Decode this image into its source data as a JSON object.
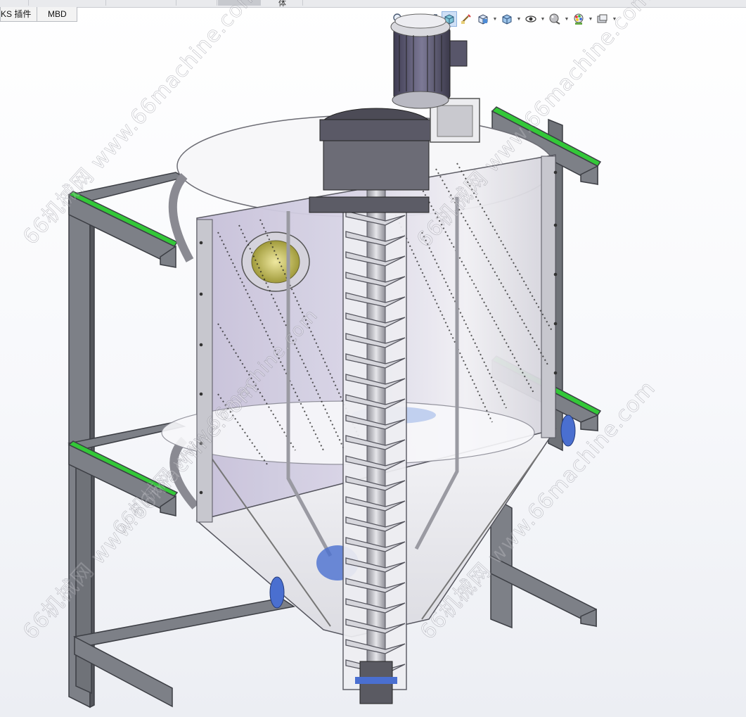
{
  "command_tabs": [
    {
      "label": "KS 插件"
    },
    {
      "label": "MBD"
    }
  ],
  "top_strip": {
    "partial_char": "体"
  },
  "heads_up_toolbar": [
    {
      "icon": "zoom-to-fit-icon"
    },
    {
      "icon": "zoom-to-area-icon"
    },
    {
      "icon": "previous-view-icon"
    },
    {
      "icon": "section-view-icon",
      "active": true
    },
    {
      "icon": "dynamic-annotation-icon"
    },
    {
      "icon": "view-orientation-icon",
      "dropdown": true
    },
    {
      "icon": "display-style-icon",
      "dropdown": true
    },
    {
      "icon": "hide-show-items-icon",
      "dropdown": true
    },
    {
      "icon": "edit-appearance-icon",
      "dropdown": true
    },
    {
      "icon": "apply-scene-icon",
      "dropdown": true
    },
    {
      "icon": "view-settings-icon",
      "dropdown": true
    }
  ],
  "watermarks": [
    {
      "text": "66机械网 www.66machine.com"
    },
    {
      "text": "66机械网 www.66machine.com"
    },
    {
      "text": "66机械网 www.66machine.com"
    },
    {
      "text": "66机械网 www.66machine.com"
    },
    {
      "text": "66机械网 www.66machine.com"
    }
  ],
  "colors": {
    "frame_steel": "#7d8087",
    "frame_highlight": "#35c83a",
    "tank_glass": "#c9c4dc",
    "motor_body": "#5b5870",
    "flange_blue": "#4a6fd0",
    "sight_glass_yellow": "#d8cf6a"
  }
}
